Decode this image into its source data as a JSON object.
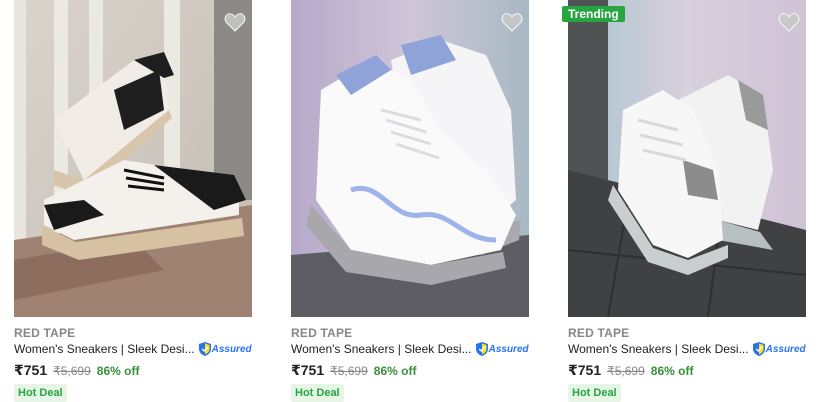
{
  "products": [
    {
      "brand": "RED TAPE",
      "title": "Women's Sneakers | Sleek Desi...",
      "assured": "Assured",
      "price": "₹751",
      "mrp": "₹5,699",
      "discount": "86% off",
      "deal": "Hot Deal",
      "image": "black-beige-sneakers"
    },
    {
      "brand": "RED TAPE",
      "title": "Women's Sneakers | Sleek Desi...",
      "assured": "Assured",
      "price": "₹751",
      "mrp": "₹5,699",
      "discount": "86% off",
      "deal": "Hot Deal",
      "image": "white-lavender-sneakers"
    },
    {
      "badge": "Trending",
      "brand": "RED TAPE",
      "title": "Women's Sneakers | Sleek Desi...",
      "assured": "Assured",
      "price": "₹751",
      "mrp": "₹5,699",
      "discount": "86% off",
      "deal": "Hot Deal",
      "image": "white-grey-sneakers"
    }
  ],
  "colors": {
    "accent": "#2874f0",
    "discount": "#388e3c",
    "deal": "#26a541"
  },
  "icons": {
    "wishlist": "heart-icon",
    "assured": "shield-icon"
  }
}
